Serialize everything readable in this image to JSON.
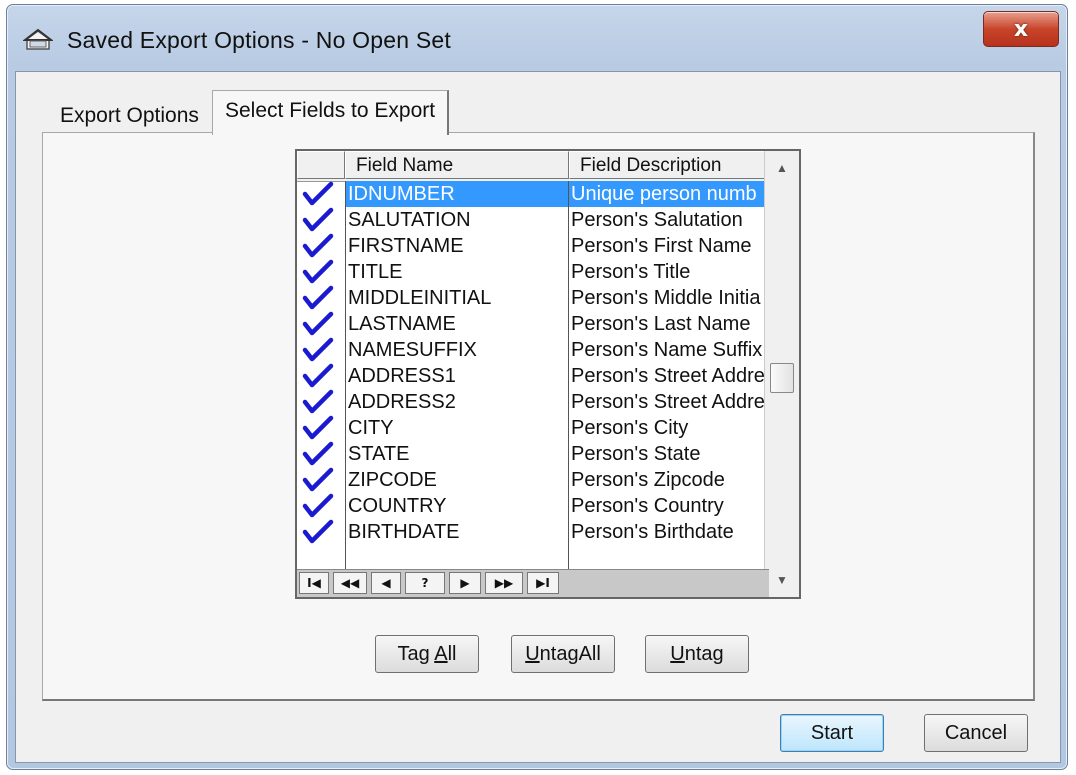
{
  "window": {
    "title": "Saved Export Options - No Open Set",
    "close_label": "x"
  },
  "tabs": [
    {
      "label": "Export Options",
      "active": false
    },
    {
      "label": "Select Fields to Export",
      "active": true
    }
  ],
  "grid": {
    "columns": [
      "Field Name",
      "Field Description"
    ],
    "rows": [
      {
        "checked": true,
        "name": "IDNUMBER",
        "description": "Unique person numb",
        "selected": true
      },
      {
        "checked": true,
        "name": "SALUTATION",
        "description": "Person's Salutation"
      },
      {
        "checked": true,
        "name": "FIRSTNAME",
        "description": "Person's First Name"
      },
      {
        "checked": true,
        "name": "TITLE",
        "description": "Person's Title"
      },
      {
        "checked": true,
        "name": "MIDDLEINITIAL",
        "description": "Person's Middle Initia"
      },
      {
        "checked": true,
        "name": "LASTNAME",
        "description": "Person's Last Name"
      },
      {
        "checked": true,
        "name": "NAMESUFFIX",
        "description": "Person's Name Suffix"
      },
      {
        "checked": true,
        "name": "ADDRESS1",
        "description": "Person's Street Addre"
      },
      {
        "checked": true,
        "name": "ADDRESS2",
        "description": "Person's Street Addre"
      },
      {
        "checked": true,
        "name": "CITY",
        "description": "Person's City"
      },
      {
        "checked": true,
        "name": "STATE",
        "description": "Person's State"
      },
      {
        "checked": true,
        "name": "ZIPCODE",
        "description": "Person's Zipcode"
      },
      {
        "checked": true,
        "name": "COUNTRY",
        "description": "Person's Country"
      },
      {
        "checked": true,
        "name": "BIRTHDATE",
        "description": "Person's Birthdate"
      }
    ],
    "navigator": [
      "I◀",
      "◀◀",
      "◀",
      "?",
      "▶",
      "▶▶",
      "▶I"
    ]
  },
  "buttons": {
    "tag_all": {
      "pre": "Tag ",
      "ul": "A",
      "post": "ll"
    },
    "untag_all": {
      "pre": "",
      "ul": "U",
      "post": "ntagAll"
    },
    "untag": {
      "pre": "",
      "ul": "U",
      "post": "ntag"
    },
    "start": "Start",
    "cancel": "Cancel"
  },
  "colors": {
    "selection": "#3399ff",
    "checkmark": "#1a1ad0",
    "titlebar": "#c6d6ea"
  }
}
